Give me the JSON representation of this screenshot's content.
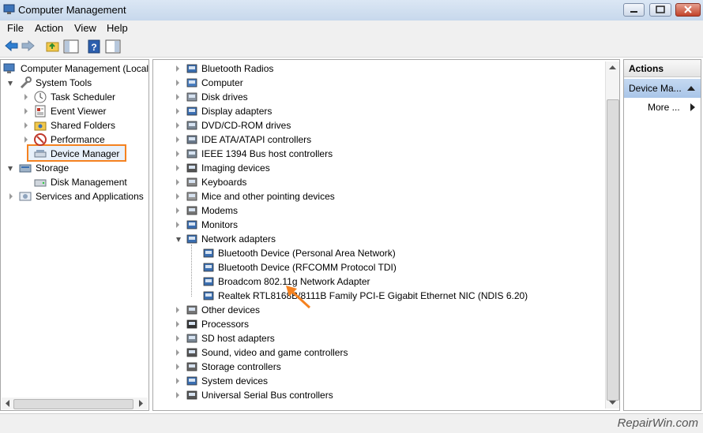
{
  "window": {
    "title": "Computer Management"
  },
  "menu": [
    "File",
    "Action",
    "View",
    "Help"
  ],
  "left_tree": {
    "root": "Computer Management (Local",
    "system_tools": "System Tools",
    "task_scheduler": "Task Scheduler",
    "event_viewer": "Event Viewer",
    "shared_folders": "Shared Folders",
    "performance": "Performance",
    "device_manager": "Device Manager",
    "storage": "Storage",
    "disk_management": "Disk Management",
    "services": "Services and Applications"
  },
  "devices": {
    "categories": [
      "Bluetooth Radios",
      "Computer",
      "Disk drives",
      "Display adapters",
      "DVD/CD-ROM drives",
      "IDE ATA/ATAPI controllers",
      "IEEE 1394 Bus host controllers",
      "Imaging devices",
      "Keyboards",
      "Mice and other pointing devices",
      "Modems",
      "Monitors",
      "Network adapters"
    ],
    "network_adapters": [
      "Bluetooth Device (Personal Area Network)",
      "Bluetooth Device (RFCOMM Protocol TDI)",
      "Broadcom 802.11g Network Adapter",
      "Realtek RTL8168B/8111B Family PCI-E Gigabit Ethernet NIC (NDIS 6.20)"
    ],
    "categories_after": [
      "Other devices",
      "Processors",
      "SD host adapters",
      "Sound, video and game controllers",
      "Storage controllers",
      "System devices",
      "Universal Serial Bus controllers"
    ]
  },
  "actions": {
    "header": "Actions",
    "selected": "Device Ma...",
    "more": "More ..."
  },
  "watermark": "RepairWin.com",
  "colors": {
    "highlight": "#f58220",
    "selection": "#c5d9f1"
  }
}
